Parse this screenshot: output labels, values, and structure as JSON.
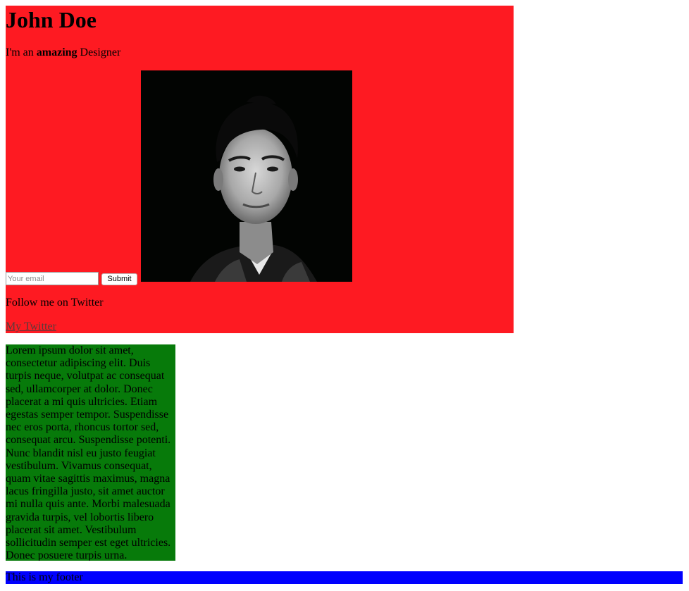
{
  "header": {
    "name": "John Doe",
    "tagline_prefix": "I'm an ",
    "tagline_bold": "amazing",
    "tagline_suffix": " Designer",
    "photo_icon": "portrait-photo",
    "email_placeholder": "Your email",
    "submit_label": "Submit",
    "follow_text": "Follow me on Twitter",
    "twitter_link": "My Twitter"
  },
  "content": {
    "paragraph": "Lorem ipsum dolor sit amet, consectetur adipiscing elit. Duis turpis neque, volutpat ac consequat sed, ullamcorper at dolor. Donec placerat a mi quis ultricies. Etiam egestas semper tempor. Suspendisse nec eros porta, rhoncus tortor sed, consequat arcu. Suspendisse potenti. Nunc blandit nisl eu justo feugiat vestibulum. Vivamus consequat, quam vitae sagittis maximus, magna lacus fringilla justo, sit amet auctor mi nulla quis ante. Morbi malesuada gravida turpis, vel lobortis libero placerat sit amet. Vestibulum sollicitudin semper est eget ultricies. Donec posuere turpis urna."
  },
  "footer": {
    "text": "This is my footer"
  },
  "colors": {
    "header_bg": "#fe1a22",
    "content_bg": "#077a0a",
    "footer_bg": "#0000fe"
  }
}
